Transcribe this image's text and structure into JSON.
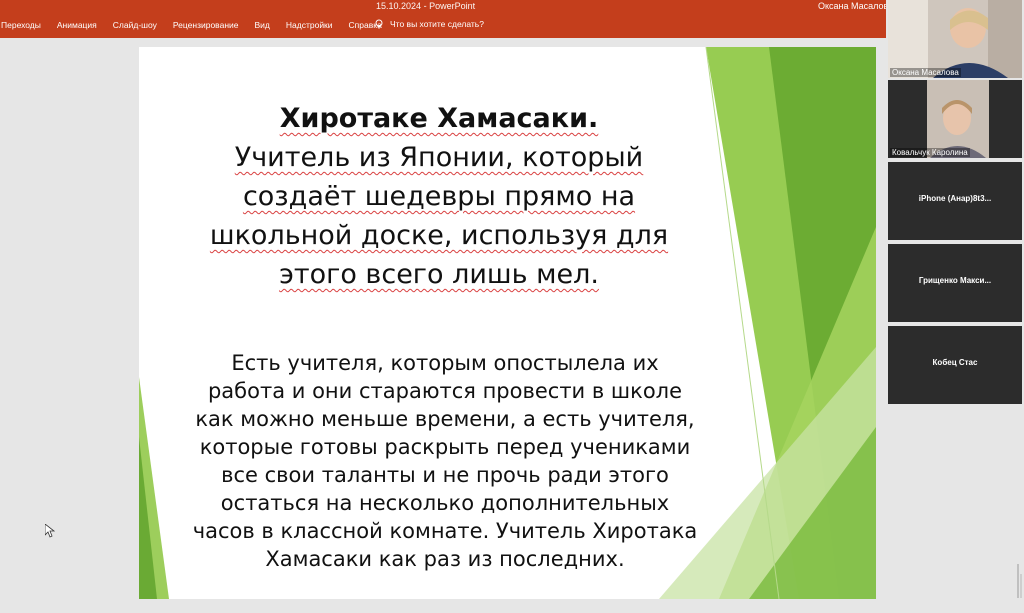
{
  "window": {
    "datetime": "15.10.2024",
    "separator": "-",
    "app_name": "PowerPoint",
    "account_name": "Оксана Масалова"
  },
  "ribbon": {
    "tabs": [
      {
        "label": "Переходы"
      },
      {
        "label": "Анимация"
      },
      {
        "label": "Слайд-шоу"
      },
      {
        "label": "Рецензирование"
      },
      {
        "label": "Вид"
      },
      {
        "label": "Надстройки"
      },
      {
        "label": "Справка"
      }
    ],
    "tell_me_icon": "lightbulb-icon",
    "tell_me_placeholder": "Что вы хотите сделать?"
  },
  "slide": {
    "title_line1": "Хиротаке Хамасаки.",
    "title_rest": [
      "Учитель из Японии, который",
      "создаёт шедевры прямо на",
      "школьной доске, используя для",
      "этого всего лишь мел."
    ],
    "body_lines": [
      "Есть учителя, которым опостылела их",
      "работа и они стараются провести в школе",
      "как можно меньше времени, а есть учителя,",
      "которые готовы раскрыть перед учениками",
      "все свои таланты и не прочь ради этого",
      "остаться на несколько дополнительных",
      "часов в классной комнате. Учитель Хиротака",
      "Хамасаки как раз из последних."
    ],
    "colors": {
      "green_light": "#c8e3a4",
      "green_mid": "#8cc63f",
      "green_dark": "#5ea12a"
    }
  },
  "participants": [
    {
      "name": "Оксана Масалова",
      "has_video": true
    },
    {
      "name": "Ковальчук Каролина",
      "has_video": true
    },
    {
      "name": "iPhone (Анар)8t3...",
      "has_video": false
    },
    {
      "name": "Грищенко Макси...",
      "has_video": false
    },
    {
      "name": "Кобец Стас",
      "has_video": false
    }
  ]
}
